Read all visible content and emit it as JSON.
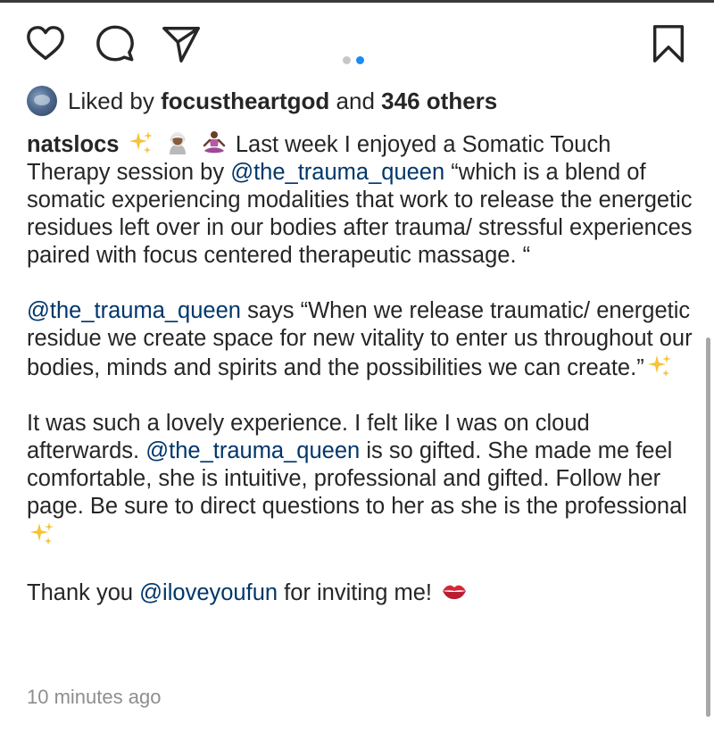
{
  "post": {
    "liked_by_prefix": "Liked by",
    "liked_by_user": "focustheartgod",
    "liked_and": "and",
    "liked_others": "346 others",
    "carousel": {
      "count": 2,
      "active_index": 2
    }
  },
  "caption": {
    "username": "natslocs",
    "p1_text_a": "Last week I enjoyed a Somatic Touch Therapy session by",
    "p1_mention": "@the_trauma_queen",
    "p1_text_b": "“which is a blend of somatic experiencing modalities that work to release the energetic residues left over in our bodies after trauma/ stressful experiences paired with focus centered therapeutic massage. “",
    "p2_mention": "@the_trauma_queen",
    "p2_text": "says “When we release traumatic/ energetic residue we create space for new vitality to enter us throughout our bodies, minds and spirits and the possibilities we can create.”",
    "p3_text_a": "It was such a lovely experience. I felt like I was on cloud afterwards.",
    "p3_mention": "@the_trauma_queen",
    "p3_text_b": "is so gifted. She made me feel comfortable, she is intuitive, professional and gifted. Follow her page. Be sure to direct questions to her as she is the professional",
    "p4_text_a": "Thank you",
    "p4_mention": "@iloveyoufun",
    "p4_text_b": "for inviting me!"
  },
  "timestamp": "10 minutes ago",
  "icons": {
    "like": "heart-icon",
    "comment": "comment-bubble-icon",
    "share": "paper-plane-icon",
    "save": "bookmark-icon",
    "sparkles": "sparkles-emoji",
    "person": "white-haired-person-emoji",
    "meditation": "person-in-lotus-position-emoji",
    "kiss": "kiss-mark-emoji"
  },
  "colors": {
    "text": "#262626",
    "mention": "#00376b",
    "muted": "#8e8e8e",
    "active_dot": "#1a8cf3",
    "inactive_dot": "#c7c7c7"
  }
}
